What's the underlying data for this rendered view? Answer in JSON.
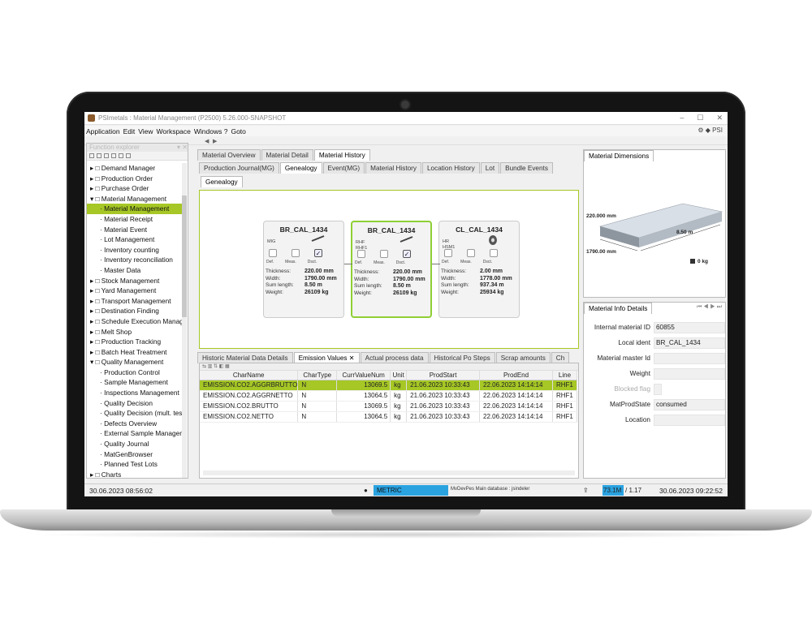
{
  "window": {
    "title": "PSImetals : Material Management (P2500) 5.26.000-SNAPSHOT",
    "brand": "PSI",
    "controls": [
      "–",
      "☐",
      "✕"
    ]
  },
  "menu": [
    "Application",
    "Edit",
    "View",
    "Workspace",
    "Windows ?",
    "Goto"
  ],
  "explorer": {
    "title": "Function explorer",
    "items": [
      {
        "label": "Demand Manager",
        "level": 0
      },
      {
        "label": "Production Order",
        "level": 0
      },
      {
        "label": "Purchase Order",
        "level": 0
      },
      {
        "label": "Material Management",
        "level": 0,
        "expanded": true
      },
      {
        "label": "Material Management",
        "level": 1,
        "selected": true
      },
      {
        "label": "Material Receipt",
        "level": 1
      },
      {
        "label": "Material Event",
        "level": 1
      },
      {
        "label": "Lot Management",
        "level": 1
      },
      {
        "label": "Inventory counting",
        "level": 1
      },
      {
        "label": "Inventory reconciliation",
        "level": 1
      },
      {
        "label": "Master Data",
        "level": 1
      },
      {
        "label": "Stock Management",
        "level": 0
      },
      {
        "label": "Yard Management",
        "level": 0
      },
      {
        "label": "Transport Management",
        "level": 0
      },
      {
        "label": "Destination Finding",
        "level": 0
      },
      {
        "label": "Schedule Execution Management",
        "level": 0
      },
      {
        "label": "Melt Shop",
        "level": 0
      },
      {
        "label": "Production Tracking",
        "level": 0
      },
      {
        "label": "Batch Heat Treatment",
        "level": 0
      },
      {
        "label": "Quality Management",
        "level": 0,
        "expanded": true
      },
      {
        "label": "Production Control",
        "level": 1
      },
      {
        "label": "Sample Management",
        "level": 1
      },
      {
        "label": "Inspections Management",
        "level": 1
      },
      {
        "label": "Quality Decision",
        "level": 1
      },
      {
        "label": "Quality Decision (mult. tests)",
        "level": 1
      },
      {
        "label": "Defects Overview",
        "level": 1
      },
      {
        "label": "External Sample Management",
        "level": 1
      },
      {
        "label": "Quality Journal",
        "level": 1
      },
      {
        "label": "MatGenBrowser",
        "level": 1
      },
      {
        "label": "Planned Test Lots",
        "level": 1
      },
      {
        "label": "Charts",
        "level": 0
      }
    ]
  },
  "center": {
    "top_tabs": [
      {
        "label": "Material Overview"
      },
      {
        "label": "Material Detail"
      },
      {
        "label": "Material History",
        "active": true
      }
    ],
    "sub_tabs": [
      {
        "label": "Production Journal(MG)"
      },
      {
        "label": "Genealogy",
        "active": true
      },
      {
        "label": "Event(MG)"
      },
      {
        "label": "Material History"
      },
      {
        "label": "Location History"
      },
      {
        "label": "Lot"
      },
      {
        "label": "Bundle Events"
      }
    ],
    "genealogy_tab": "Genealogy",
    "cards": [
      {
        "name": "BR_CAL_1434",
        "proc": "MIG",
        "chk_def": false,
        "chk_meas": false,
        "chk_dsct": true,
        "thickness": "220.00 mm",
        "width": "1790.00 mm",
        "sum_length": "8.50 m",
        "weight": "26109 kg",
        "icon": "bar-icon"
      },
      {
        "name": "BR_CAL_1434",
        "proc": "RHF\nRHF1",
        "chk_def": false,
        "chk_meas": false,
        "chk_dsct": true,
        "thickness": "220.00 mm",
        "width": "1790.00 mm",
        "sum_length": "8.50 m",
        "weight": "26109 kg",
        "icon": "bar-icon"
      },
      {
        "name": "CL_CAL_1434",
        "proc": "HR\nHSM1",
        "chk_def": false,
        "chk_meas": false,
        "chk_dsct": false,
        "thickness": "2.00 mm",
        "width": "1778.00 mm",
        "sum_length": "937.34 m",
        "weight": "25934 kg",
        "icon": "coil-icon"
      }
    ],
    "card_labels": {
      "def": "Def.",
      "meas": "Meas.",
      "dsct": "Dsct.",
      "thickness": "Thickness:",
      "width": "Width:",
      "sum_length": "Sum length:",
      "weight": "Weight:"
    },
    "bottom_tabs": [
      {
        "label": "Historic Material Data Details"
      },
      {
        "label": "Emission Values ✕",
        "active": true
      },
      {
        "label": "Actual process data"
      },
      {
        "label": "Historical Po Steps"
      },
      {
        "label": "Scrap amounts"
      },
      {
        "label": "Ch"
      }
    ],
    "grid": {
      "columns": [
        "CharName",
        "CharType",
        "CurrValueNum",
        "Unit",
        "ProdStart",
        "ProdEnd",
        "Line"
      ],
      "rows": [
        [
          "EMISSION.CO2.AGGRBRUTTO",
          "N",
          "13069.5",
          "kg",
          "21.06.2023 10:33:43",
          "22.06.2023 14:14:14",
          "RHF1"
        ],
        [
          "EMISSION.CO2.AGGRNETTO",
          "N",
          "13064.5",
          "kg",
          "21.06.2023 10:33:43",
          "22.06.2023 14:14:14",
          "RHF1"
        ],
        [
          "EMISSION.CO2.BRUTTO",
          "N",
          "13069.5",
          "kg",
          "21.06.2023 10:33:43",
          "22.06.2023 14:14:14",
          "RHF1"
        ],
        [
          "EMISSION.CO2.NETTO",
          "N",
          "13064.5",
          "kg",
          "21.06.2023 10:33:43",
          "22.06.2023 14:14:14",
          "RHF1"
        ]
      ]
    }
  },
  "right": {
    "dim_tab": "Material Dimensions",
    "dims": {
      "thickness": "220.000 mm",
      "width": "1790.00 mm",
      "length": "8.50 m",
      "weight": "0 kg"
    },
    "info_tab": "Material Info Details",
    "info": [
      {
        "label": "Internal material ID",
        "value": "60855"
      },
      {
        "label": "Local ident",
        "value": "BR_CAL_1434"
      },
      {
        "label": "Material master Id",
        "value": ""
      },
      {
        "label": "Weight",
        "value": ""
      },
      {
        "label": "Blocked flag",
        "value": "",
        "dim": true
      },
      {
        "label": "MatProdState",
        "value": "consumed"
      },
      {
        "label": "Location",
        "value": ""
      }
    ]
  },
  "status": {
    "time_left": "30.06.2023 08:56:02",
    "unit_system": "METRIC",
    "database": "MvDevPes Main database : jsindeler",
    "memory": "73.1M",
    "memory_total": "/ 1.17",
    "time_right": "30.06.2023 09:22:52"
  }
}
